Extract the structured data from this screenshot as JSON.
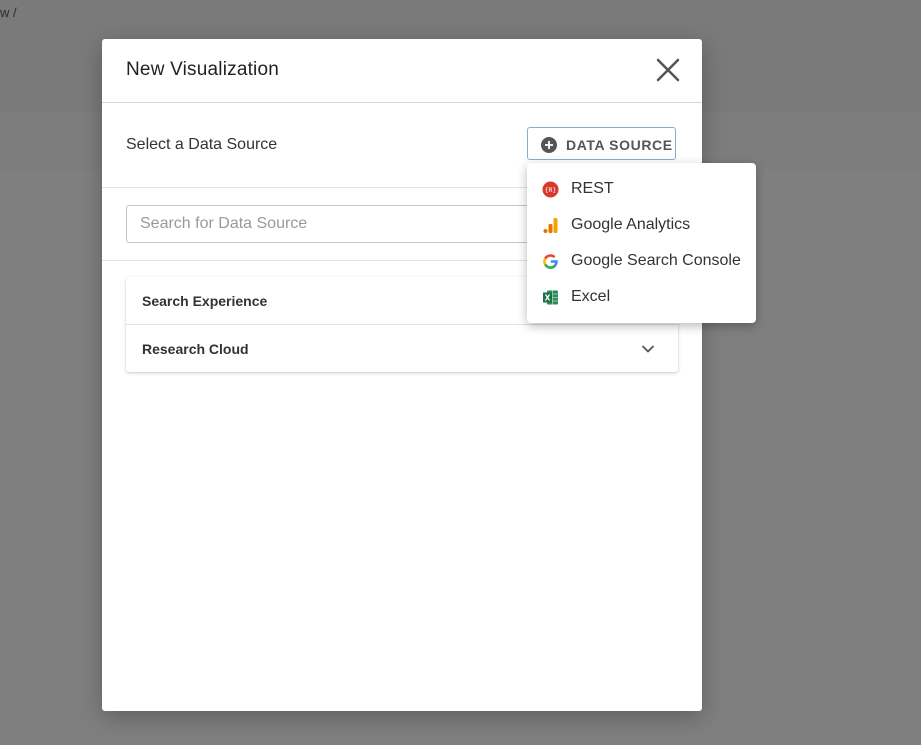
{
  "background": {
    "breadcrumb": "w  /"
  },
  "modal": {
    "title": "New Visualization",
    "select_label": "Select a Data Source",
    "data_source_button": "DATA SOURCE",
    "search_placeholder": "Search for Data Source",
    "groups": [
      {
        "label": "Search Experience"
      },
      {
        "label": "Research Cloud"
      }
    ]
  },
  "menu": {
    "items": [
      {
        "label": "REST",
        "icon": "rest-icon"
      },
      {
        "label": "Google Analytics",
        "icon": "google-analytics-icon"
      },
      {
        "label": "Google Search Console",
        "icon": "google-g-icon"
      },
      {
        "label": "Excel",
        "icon": "excel-icon"
      }
    ]
  },
  "colors": {
    "backdrop": "#000000",
    "button_border": "#7fb0d6",
    "rest_red": "#d9392b",
    "analytics_orange": "#f4a300",
    "excel_green": "#1e7145"
  }
}
